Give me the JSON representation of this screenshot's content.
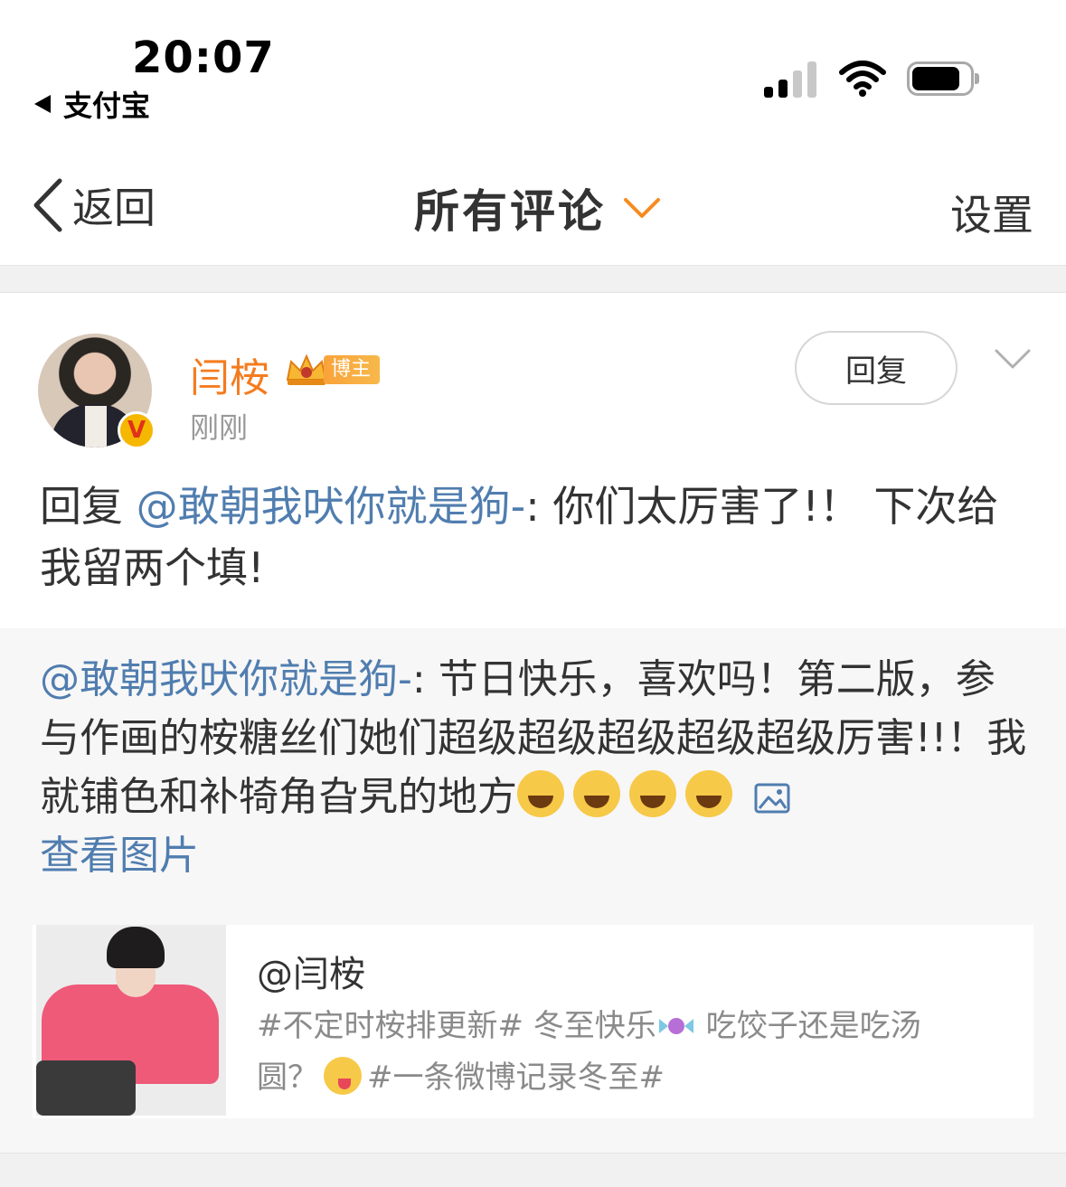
{
  "status_bar": {
    "time": "20:07",
    "back_app_label": "支付宝"
  },
  "nav": {
    "back_label": "返回",
    "title": "所有评论",
    "settings_label": "设置",
    "accent_color": "#f68b1f"
  },
  "comment": {
    "author": "闫桉",
    "badge_label": "博主",
    "verified_mark": "V",
    "timestamp": "刚刚",
    "reply_button_label": "回复",
    "body_prefix": "回复 ",
    "mention": "@敢朝我吠你就是狗-",
    "body_text": ": 你们太厉害了!！  下次给我留两个填!"
  },
  "quoted": {
    "mention": "@敢朝我吠你就是狗-",
    "text": ": 节日快乐，喜欢吗！第二版，参与作画的桉糖丝们她们超级超级超级超级超级厉害!!！我就铺色和补犄角旮旯的地方",
    "emoji_names": [
      "laugh-cry-emoji",
      "laugh-cry-emoji",
      "laugh-cry-emoji",
      "laugh-cry-emoji"
    ],
    "view_image_label": "查看图片",
    "card": {
      "title": "@闫桉",
      "desc_part1": "#不定时桉排更新# 冬至快乐",
      "desc_part2": " 吃饺子还是吃汤圆？",
      "desc_part3": "#一条微博记录冬至#"
    }
  }
}
